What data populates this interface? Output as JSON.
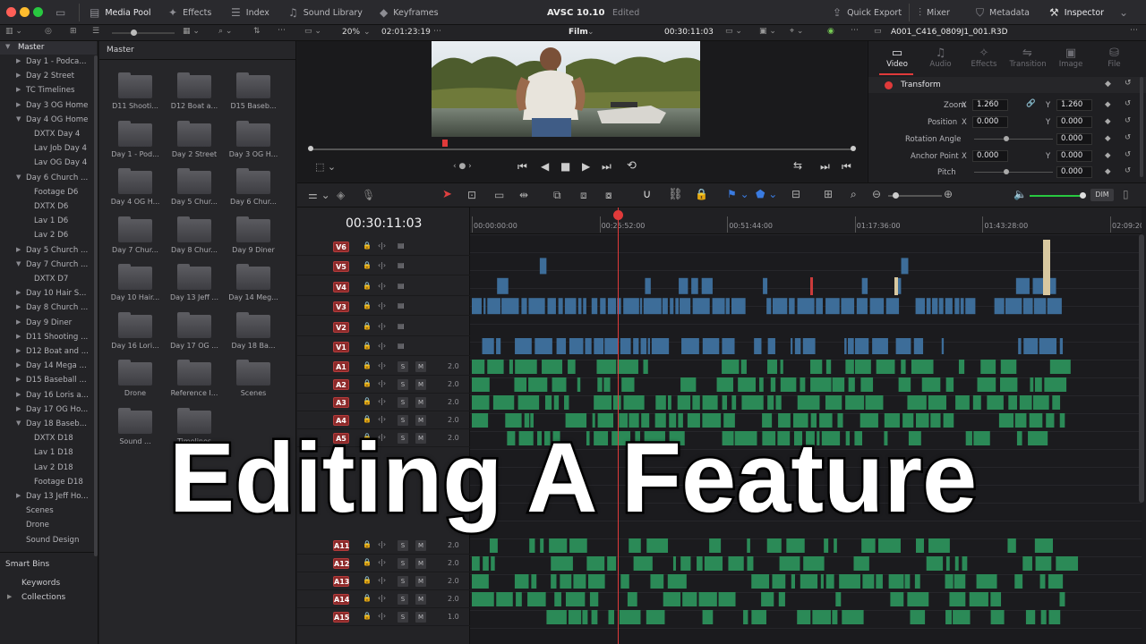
{
  "topbar": {
    "media_pool": "Media Pool",
    "effects": "Effects",
    "index": "Index",
    "sound_library": "Sound Library",
    "keyframes": "Keyframes",
    "project_title": "AVSC 10.10",
    "project_status": "Edited",
    "quick_export": "Quick Export",
    "mixer": "Mixer",
    "metadata": "Metadata",
    "inspector": "Inspector"
  },
  "subbar": {
    "zoom": "20%",
    "source_timecode": "02:01:23:19",
    "timeline_name": "Film",
    "record_timecode": "00:30:11:03",
    "clip_name": "A001_C416_0809J1_001.R3D"
  },
  "sidebar": {
    "root": "Master",
    "items": [
      {
        "label": "Day 1 - Podca...",
        "indent": 1,
        "arrow": "▶"
      },
      {
        "label": "Day 2 Street",
        "indent": 1,
        "arrow": "▶"
      },
      {
        "label": "TC Timelines",
        "indent": 1,
        "arrow": "▶"
      },
      {
        "label": "Day 3 OG Home",
        "indent": 1,
        "arrow": "▶"
      },
      {
        "label": "Day 4 OG Home",
        "indent": 1,
        "arrow": "▼"
      },
      {
        "label": "DXTX Day 4",
        "indent": 2,
        "arrow": ""
      },
      {
        "label": "Lav Job Day 4",
        "indent": 2,
        "arrow": ""
      },
      {
        "label": "Lav OG Day 4",
        "indent": 2,
        "arrow": ""
      },
      {
        "label": "Day 6 Church ...",
        "indent": 1,
        "arrow": "▼"
      },
      {
        "label": "Footage D6",
        "indent": 2,
        "arrow": ""
      },
      {
        "label": "DXTX D6",
        "indent": 2,
        "arrow": ""
      },
      {
        "label": "Lav 1 D6",
        "indent": 2,
        "arrow": ""
      },
      {
        "label": "Lav 2 D6",
        "indent": 2,
        "arrow": ""
      },
      {
        "label": "Day 5 Church ...",
        "indent": 1,
        "arrow": "▶"
      },
      {
        "label": "Day 7 Church ...",
        "indent": 1,
        "arrow": "▼"
      },
      {
        "label": "DXTX D7",
        "indent": 2,
        "arrow": ""
      },
      {
        "label": "Day 10 Hair S...",
        "indent": 1,
        "arrow": "▶"
      },
      {
        "label": "Day 8 Church ...",
        "indent": 1,
        "arrow": "▶"
      },
      {
        "label": "Day 9 Diner",
        "indent": 1,
        "arrow": "▶"
      },
      {
        "label": "D11 Shooting ...",
        "indent": 1,
        "arrow": "▶"
      },
      {
        "label": "D12 Boat and ...",
        "indent": 1,
        "arrow": "▶"
      },
      {
        "label": "Day 14 Mega ...",
        "indent": 1,
        "arrow": "▶"
      },
      {
        "label": "D15 Baseball ...",
        "indent": 1,
        "arrow": "▶"
      },
      {
        "label": "Day 16 Loris a...",
        "indent": 1,
        "arrow": "▶"
      },
      {
        "label": "Day 17 OG Ho...",
        "indent": 1,
        "arrow": "▶"
      },
      {
        "label": "Day 18 Baseb...",
        "indent": 1,
        "arrow": "▼"
      },
      {
        "label": "DXTX D18",
        "indent": 2,
        "arrow": ""
      },
      {
        "label": "Lav 1 D18",
        "indent": 2,
        "arrow": ""
      },
      {
        "label": "Lav 2 D18",
        "indent": 2,
        "arrow": ""
      },
      {
        "label": "Footage D18",
        "indent": 2,
        "arrow": ""
      },
      {
        "label": "Day 13 Jeff Ho...",
        "indent": 1,
        "arrow": "▶"
      },
      {
        "label": "Scenes",
        "indent": 1,
        "arrow": ""
      },
      {
        "label": "Drone",
        "indent": 1,
        "arrow": ""
      },
      {
        "label": "Sound Design",
        "indent": 1,
        "arrow": ""
      }
    ],
    "smart_bins": "Smart Bins",
    "keywords": "Keywords",
    "collections": "Collections"
  },
  "pool": {
    "header": "Master",
    "folders": [
      "D11 Shooti...",
      "D12 Boat a...",
      "D15 Baseb...",
      "Day 1 - Pod...",
      "Day 2 Street",
      "Day 3 OG H...",
      "Day 4 OG H...",
      "Day 5 Chur...",
      "Day 6 Chur...",
      "Day 7 Chur...",
      "Day 8 Chur...",
      "Day 9 Diner",
      "Day 10 Hair...",
      "Day 13 Jeff ...",
      "Day 14 Meg...",
      "Day 16 Lori...",
      "Day 17 OG ...",
      "Day 18 Ba...",
      "Drone",
      "Reference I...",
      "Scenes",
      "Sound ...",
      "Timelines"
    ]
  },
  "inspector": {
    "tabs": [
      {
        "label": "Video",
        "active": true,
        "icon": "▭"
      },
      {
        "label": "Audio",
        "active": false,
        "icon": "♫"
      },
      {
        "label": "Effects",
        "active": false,
        "icon": "✧"
      },
      {
        "label": "Transition",
        "active": false,
        "icon": "⇋"
      },
      {
        "label": "Image",
        "active": false,
        "icon": "▣"
      },
      {
        "label": "File",
        "active": false,
        "icon": "⛁"
      }
    ],
    "section": "Transform",
    "zoom_label": "Zoom",
    "zoom_x": "1.260",
    "zoom_y": "1.260",
    "position_label": "Position",
    "position_x": "0.000",
    "position_y": "0.000",
    "rotation_label": "Rotation Angle",
    "rotation": "0.000",
    "anchor_label": "Anchor Point",
    "anchor_x": "0.000",
    "anchor_y": "0.000",
    "pitch_label": "Pitch",
    "pitch": "0.000",
    "x": "X",
    "y": "Y"
  },
  "timeline": {
    "timecode": "00:30:11:03",
    "ruler": [
      "00:00:00:00",
      "00:25:52:00",
      "00:51:44:00",
      "01:17:36:00",
      "01:43:28:00",
      "02:09:20"
    ],
    "dim": "DIM",
    "playhead_fraction": 0.22,
    "video_tracks": [
      "V6",
      "V5",
      "V4",
      "V3",
      "V2",
      "V1"
    ],
    "audio_tracks_top": [
      {
        "name": "A1",
        "vol": "2.0"
      },
      {
        "name": "A2",
        "vol": "2.0"
      },
      {
        "name": "A3",
        "vol": "2.0"
      },
      {
        "name": "A4",
        "vol": "2.0"
      },
      {
        "name": "A5",
        "vol": "2.0"
      }
    ],
    "audio_tracks_bottom": [
      {
        "name": "A11",
        "vol": "2.0"
      },
      {
        "name": "A12",
        "vol": "2.0"
      },
      {
        "name": "A13",
        "vol": "2.0"
      },
      {
        "name": "A14",
        "vol": "2.0"
      },
      {
        "name": "A15",
        "vol": "1.0"
      }
    ],
    "s": "S",
    "m": "M"
  },
  "overlay_title": "Editing A Feature",
  "colors": {
    "clip_blue": "#3d6d99",
    "clip_green": "#2b8a57",
    "playhead": "#e03a3a",
    "track_red": "#8c2a2a"
  }
}
